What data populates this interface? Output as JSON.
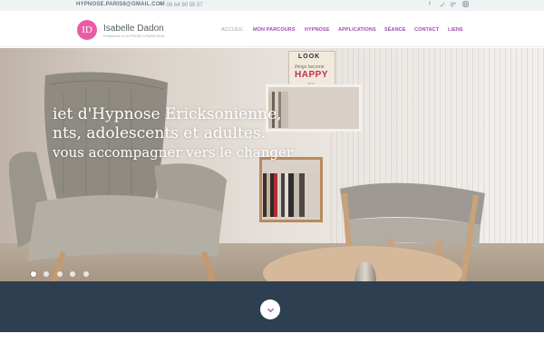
{
  "topbar": {
    "email": "HYPNOSE.PARIS8@GMAIL.COM",
    "phone": "06 64 90 55 07",
    "social_icons": [
      "facebook-icon",
      "twitter-icon",
      "google-plus-icon",
      "instagram-icon"
    ]
  },
  "header": {
    "logo_initials": "ID",
    "logo_name": "Isabelle Dadon",
    "logo_tagline": "Praticienne en HYPNOSE à PARIS 8ème"
  },
  "nav": {
    "items": [
      {
        "label": "ACCUEIL",
        "active": true
      },
      {
        "label": "MON PARCOURS",
        "active": false
      },
      {
        "label": "HYPNOSE",
        "active": false
      },
      {
        "label": "APPLICATIONS",
        "active": false
      },
      {
        "label": "SÉANCE",
        "active": false
      },
      {
        "label": "CONTACT",
        "active": false
      },
      {
        "label": "LIENS",
        "active": false
      }
    ]
  },
  "hero": {
    "caption_line1": "iet d'Hypnose Ericksonienne,",
    "caption_line2": "nts, adolescents et adultes.",
    "caption_line3": "vous accompagner vers le changer",
    "sign_line1": "LOOK",
    "sign_line2": "things become",
    "sign_line3": "HAPPY",
    "sign_line4": "TOO",
    "slide_count": 5,
    "active_slide": 1
  },
  "band": {
    "scroll_icon": "chevron-down-icon"
  },
  "colors": {
    "accent": "#a14ab2",
    "logo_pink": "#e95ba6",
    "band": "#2f3f52",
    "topbar_bg": "#eef3f4"
  }
}
